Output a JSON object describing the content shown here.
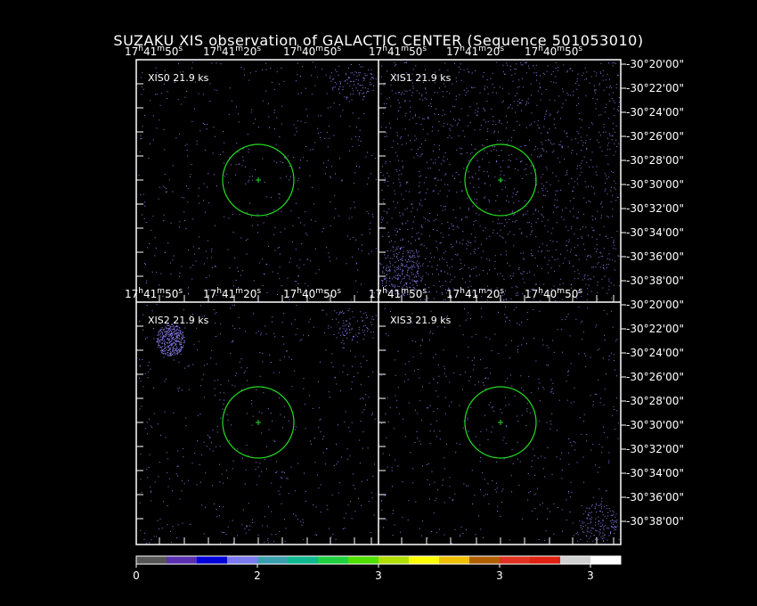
{
  "title": "SUZAKU XIS observation of GALACTIC CENTER  (Sequence 501053010)",
  "panels": [
    {
      "label": "XIS0 21.9 ks",
      "density": 0.35,
      "hotspots": [
        {
          "where": "top-right",
          "density": 0.6
        }
      ]
    },
    {
      "label": "XIS1 21.9 ks",
      "density": 1.0,
      "hotspots": [
        {
          "where": "bottom-left",
          "density": 0.9
        }
      ]
    },
    {
      "label": "XIS2 21.9 ks",
      "density": 0.35,
      "hotspots": [
        {
          "where": "top-left-bright",
          "density": 1.0
        },
        {
          "where": "top-right",
          "density": 0.5
        }
      ]
    },
    {
      "label": "XIS3 21.9 ks",
      "density": 0.35,
      "hotspots": [
        {
          "where": "bottom-right",
          "density": 0.8
        }
      ]
    }
  ],
  "ra_labels": [
    {
      "h": "17",
      "m": "41",
      "s": "50"
    },
    {
      "h": "17",
      "m": "41",
      "s": "20"
    },
    {
      "h": "17",
      "m": "40",
      "s": "50"
    }
  ],
  "dec_labels_top": [
    "-30°20'00\"",
    "-30°22'00\"",
    "-30°24'00\"",
    "-30°26'00\"",
    "-30°28'00\"",
    "-30°30'00\"",
    "-30°32'00\"",
    "-30°34'00\"",
    "-30°36'00\"",
    "-30°38'00\""
  ],
  "dec_labels_bottom": [
    "-30°20'00\"",
    "-30°22'00\"",
    "-30°24'00\"",
    "-30°26'00\"",
    "-30°28'00\"",
    "-30°30'00\"",
    "-30°32'00\"",
    "-30°34'00\"",
    "-30°36'00\"",
    "-30°38'00\""
  ],
  "colorbar": {
    "colors": [
      "#555555",
      "#5a2fb0",
      "#0000d8",
      "#7a7aee",
      "#3aa0b0",
      "#10b890",
      "#20d040",
      "#50e000",
      "#b0e000",
      "#ffff00",
      "#f0c000",
      "#b06000",
      "#e03020",
      "#e02010",
      "#d0d0d0",
      "#ffffff"
    ],
    "labels": [
      "0",
      "2",
      "3",
      "3",
      "3"
    ]
  },
  "source_circle_color": "#22dd22",
  "event_color": "#8a7cf0"
}
